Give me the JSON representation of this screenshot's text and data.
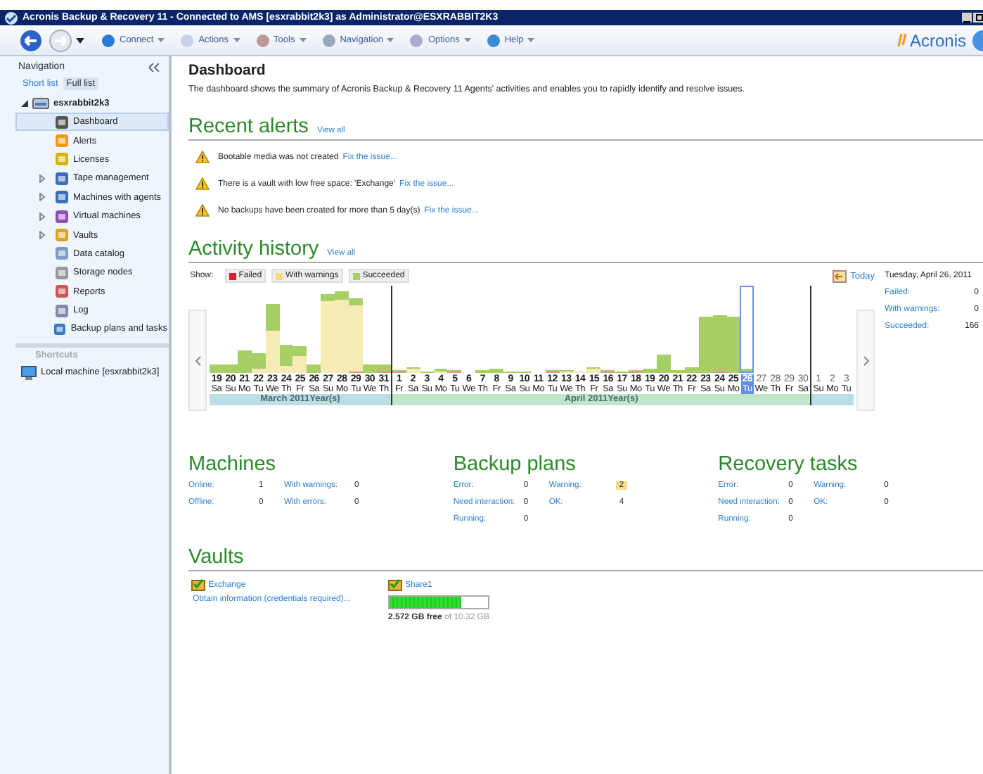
{
  "window": {
    "title": "Acronis Backup & Recovery 11 - Connected to AMS [esxrabbit2k3] as Administrator@ESXRABBIT2K3"
  },
  "toolbar": {
    "menus": [
      "Connect",
      "Actions",
      "Tools",
      "Navigation",
      "Options",
      "Help"
    ],
    "logo": "Acronis"
  },
  "navigation": {
    "title": "Navigation",
    "tabs": [
      {
        "label": "Short list",
        "selected": false
      },
      {
        "label": "Full list",
        "selected": true
      }
    ],
    "root": {
      "label": "esxrabbit2k3",
      "expanded": true,
      "children": [
        {
          "label": "Dashboard",
          "selected": true,
          "expandable": false
        },
        {
          "label": "Alerts",
          "selected": false,
          "expandable": false
        },
        {
          "label": "Licenses",
          "selected": false,
          "expandable": false
        },
        {
          "label": "Tape management",
          "selected": false,
          "expandable": true
        },
        {
          "label": "Machines with agents",
          "selected": false,
          "expandable": true
        },
        {
          "label": "Virtual machines",
          "selected": false,
          "expandable": true
        },
        {
          "label": "Vaults",
          "selected": false,
          "expandable": true
        },
        {
          "label": "Data catalog",
          "selected": false,
          "expandable": false
        },
        {
          "label": "Storage nodes",
          "selected": false,
          "expandable": false
        },
        {
          "label": "Reports",
          "selected": false,
          "expandable": false
        },
        {
          "label": "Log",
          "selected": false,
          "expandable": false
        },
        {
          "label": "Backup plans and tasks",
          "selected": false,
          "expandable": false
        }
      ]
    },
    "shortcuts_title": "Shortcuts",
    "shortcuts": [
      "Local machine [esxrabbit2k3]"
    ]
  },
  "page": {
    "title": "Dashboard",
    "description": "The dashboard shows the summary of Acronis Backup & Recovery 11 Agents' activities and enables you to rapidly identify and resolve issues."
  },
  "recent_alerts": {
    "title": "Recent alerts",
    "view_all": "View all",
    "alerts": [
      {
        "text": "Bootable media was not created",
        "link": "Fix the issue..."
      },
      {
        "text": "There is a vault with low free space: 'Exchange'",
        "link": "Fix the issue..."
      },
      {
        "text": "No backups have been created for more than 5 day(s)",
        "link": "Fix the issue..."
      }
    ]
  },
  "activity_history": {
    "title": "Activity history",
    "view_all": "View all",
    "show_label": "Show:",
    "legend": [
      {
        "label": "Failed",
        "color": "#d8232a"
      },
      {
        "label": "With warnings",
        "color": "#f9d77e"
      },
      {
        "label": "Succeeded",
        "color": "#a6cf64"
      }
    ],
    "today": "Today",
    "months": [
      {
        "label": "March 2011Year(s)",
        "days": [
          {
            "day": "19",
            "weekday": "Sa",
            "selected": false
          },
          {
            "day": "20",
            "weekday": "Su",
            "selected": false
          },
          {
            "day": "21",
            "weekday": "Mo",
            "selected": false
          },
          {
            "day": "22",
            "weekday": "Tu",
            "selected": false
          },
          {
            "day": "23",
            "weekday": "We",
            "selected": false
          },
          {
            "day": "24",
            "weekday": "Th",
            "selected": false
          },
          {
            "day": "25",
            "weekday": "Fr",
            "selected": false
          },
          {
            "day": "26",
            "weekday": "Sa",
            "selected": false
          },
          {
            "day": "27",
            "weekday": "Su",
            "selected": false
          },
          {
            "day": "28",
            "weekday": "Mo",
            "selected": false
          },
          {
            "day": "29",
            "weekday": "Tu",
            "selected": false
          },
          {
            "day": "30",
            "weekday": "We",
            "selected": false
          },
          {
            "day": "31",
            "weekday": "Th",
            "selected": false
          }
        ]
      },
      {
        "label": "April 2011Year(s)",
        "days": [
          {
            "day": "1",
            "weekday": "Fr",
            "selected": false
          },
          {
            "day": "2",
            "weekday": "Sa",
            "selected": false
          },
          {
            "day": "3",
            "weekday": "Su",
            "selected": false
          },
          {
            "day": "4",
            "weekday": "Mo",
            "selected": false
          },
          {
            "day": "5",
            "weekday": "Tu",
            "selected": false
          },
          {
            "day": "6",
            "weekday": "We",
            "selected": false
          },
          {
            "day": "7",
            "weekday": "Th",
            "selected": false
          },
          {
            "day": "8",
            "weekday": "Fr",
            "selected": false
          },
          {
            "day": "9",
            "weekday": "Sa",
            "selected": false
          },
          {
            "day": "10",
            "weekday": "Su",
            "selected": false
          },
          {
            "day": "11",
            "weekday": "Mo",
            "selected": false
          },
          {
            "day": "12",
            "weekday": "Tu",
            "selected": false
          },
          {
            "day": "13",
            "weekday": "We",
            "selected": false
          },
          {
            "day": "14",
            "weekday": "Th",
            "selected": false
          },
          {
            "day": "15",
            "weekday": "Fr",
            "selected": false
          },
          {
            "day": "16",
            "weekday": "Sa",
            "selected": false
          },
          {
            "day": "17",
            "weekday": "Su",
            "selected": false
          },
          {
            "day": "18",
            "weekday": "Mo",
            "selected": false
          },
          {
            "day": "19",
            "weekday": "Tu",
            "selected": false
          },
          {
            "day": "20",
            "weekday": "We",
            "selected": false
          },
          {
            "day": "21",
            "weekday": "Th",
            "selected": false
          },
          {
            "day": "22",
            "weekday": "Fr",
            "selected": false
          },
          {
            "day": "23",
            "weekday": "Sa",
            "selected": false
          },
          {
            "day": "24",
            "weekday": "Su",
            "selected": false
          },
          {
            "day": "25",
            "weekday": "Mo",
            "selected": false
          },
          {
            "day": "26",
            "weekday": "Tu",
            "selected": true
          },
          {
            "day": "27",
            "weekday": "We",
            "selected": false
          },
          {
            "day": "28",
            "weekday": "Th",
            "selected": false
          },
          {
            "day": "29",
            "weekday": "Fr",
            "selected": false
          },
          {
            "day": "30",
            "weekday": "Sa",
            "selected": false
          }
        ]
      },
      {
        "days": [
          {
            "day": "1",
            "weekday": "Su",
            "selected": false
          },
          {
            "day": "2",
            "weekday": "Mo",
            "selected": false
          },
          {
            "day": "3",
            "weekday": "Tu",
            "selected": false
          }
        ]
      }
    ],
    "summary": {
      "date": "Tuesday, April 26, 2011",
      "rows": [
        {
          "label": "Failed:",
          "value": "0"
        },
        {
          "label": "With warnings:",
          "value": "0"
        },
        {
          "label": "Succeeded:",
          "value": "166"
        }
      ]
    }
  },
  "stats": [
    {
      "title": "Machines",
      "columns": [
        [
          {
            "label": "Online:",
            "value": "1",
            "highlighted": false
          },
          {
            "label": "Offline:",
            "value": "0",
            "highlighted": false
          }
        ],
        [
          {
            "label": "With warnings:",
            "value": "0",
            "highlighted": false
          },
          {
            "label": "With errors:",
            "value": "0",
            "highlighted": false
          }
        ]
      ]
    },
    {
      "title": "Backup plans",
      "columns": [
        [
          {
            "label": "Error:",
            "value": "0",
            "highlighted": false
          },
          {
            "label": "Need interaction:",
            "value": "0",
            "highlighted": false
          },
          {
            "label": "Running:",
            "value": "0",
            "highlighted": false
          }
        ],
        [
          {
            "label": "Warning:",
            "value": "2",
            "highlighted": true
          },
          {
            "label": "OK:",
            "value": "4",
            "highlighted": false
          }
        ]
      ]
    },
    {
      "title": "Recovery tasks",
      "columns": [
        [
          {
            "label": "Error:",
            "value": "0",
            "highlighted": false
          },
          {
            "label": "Need interaction:",
            "value": "0",
            "highlighted": false
          },
          {
            "label": "Running:",
            "value": "0",
            "highlighted": false
          }
        ],
        [
          {
            "label": "Warning:",
            "value": "0",
            "highlighted": false
          },
          {
            "label": "OK:",
            "value": "0",
            "highlighted": false
          }
        ]
      ]
    }
  ],
  "vaults": {
    "title": "Vaults",
    "items": [
      {
        "name": "Exchange",
        "kind": "link",
        "info": "Obtain information (credentials required)..."
      },
      {
        "name": "Share1",
        "kind": "usage",
        "level": 0.73,
        "free": "2.572 GB free",
        "total": "of 10.32 GB"
      }
    ]
  }
}
